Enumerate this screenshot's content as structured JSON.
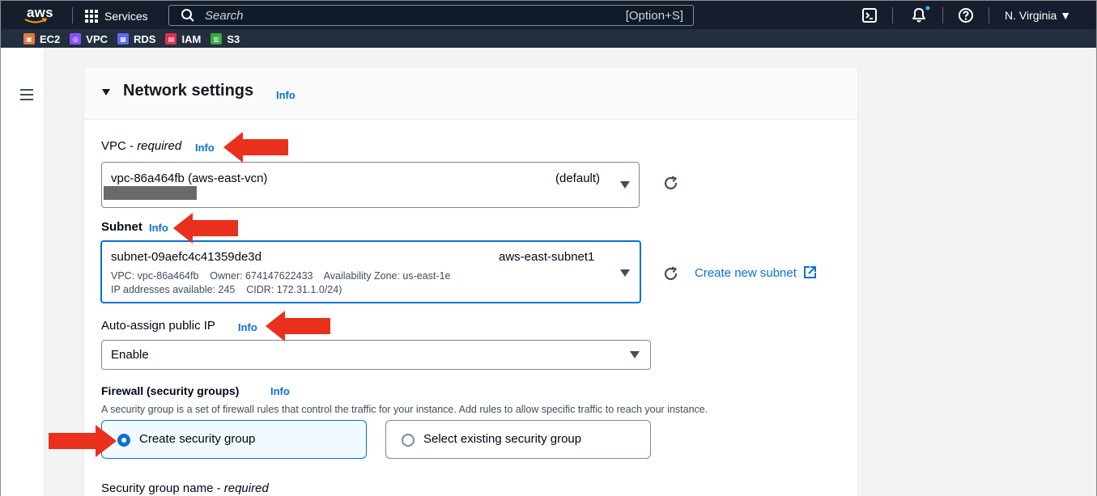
{
  "topnav": {
    "logo": "aws",
    "services_label": "Services",
    "search_placeholder": "Search",
    "search_shortcut": "[Option+S]",
    "region": "N. Virginia"
  },
  "favorites": [
    {
      "label": "EC2",
      "color": "#e07941"
    },
    {
      "label": "VPC",
      "color": "#8c4fff"
    },
    {
      "label": "RDS",
      "color": "#5c6bf0"
    },
    {
      "label": "IAM",
      "color": "#dd344c"
    },
    {
      "label": "S3",
      "color": "#3aa845"
    }
  ],
  "section": {
    "title": "Network settings",
    "info": "Info"
  },
  "vpc": {
    "label": "VPC - ",
    "label_required": "required",
    "info": "Info",
    "value": "vpc-86a464fb (aws-east-vcn)",
    "tag": "(default)"
  },
  "subnet": {
    "label": "Subnet",
    "info": "Info",
    "value": "subnet-09aefc4c41359de3d",
    "name": "aws-east-subnet1",
    "detail_1": "VPC: vpc-86a464fb    Owner: 674147622433    Availability Zone: us-east-1e",
    "detail_2": "IP addresses available: 245    CIDR: 172.31.1.0/24)",
    "create_link": "Create new subnet"
  },
  "public_ip": {
    "label": "Auto-assign public IP",
    "info": "Info",
    "value": "Enable"
  },
  "firewall": {
    "label": "Firewall (security groups)",
    "info": "Info",
    "description": "A security group is a set of firewall rules that control the traffic for your instance. Add rules to allow specific traffic to reach your instance.",
    "option_create": "Create security group",
    "option_existing": "Select existing security group",
    "selected": "create"
  },
  "sg_name": {
    "label": "Security group name - ",
    "label_required": "required"
  },
  "colors": {
    "accent": "#0972d3",
    "annotation": "#e8301c",
    "nav_dark": "#161e2d"
  }
}
